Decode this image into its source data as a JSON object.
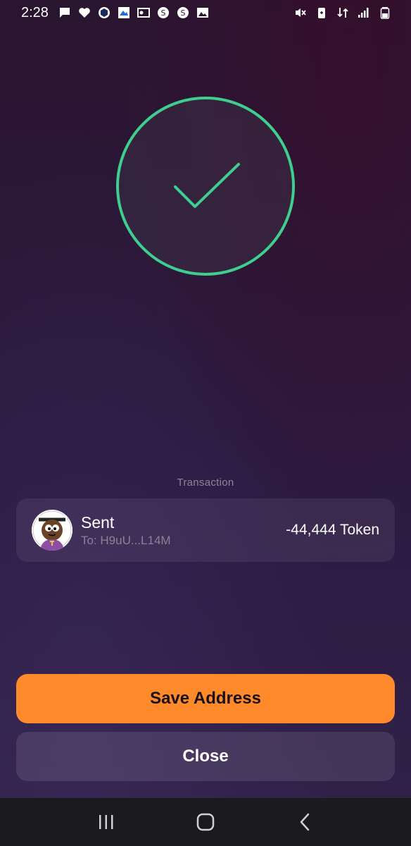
{
  "status_bar": {
    "time": "2:28",
    "left_icons": [
      "chat-bubble-icon",
      "heart-icon",
      "crypto-com-icon",
      "cloud-mountain-icon",
      "outlook-icon",
      "s-circle-icon",
      "s-circle-icon",
      "image-icon"
    ],
    "right_icons": [
      "mute-icon",
      "battery-saver-icon",
      "data-arrows-icon",
      "signal-icon",
      "battery-icon"
    ]
  },
  "success": {
    "icon": "checkmark-icon",
    "accent_color": "#3ecf8e"
  },
  "transaction": {
    "section_label": "Transaction",
    "title": "Sent",
    "recipient": "To: H9uU...L14M",
    "amount": "-44,444 Token",
    "avatar_icon": "token-avatar-icon"
  },
  "buttons": {
    "save_label": "Save Address",
    "close_label": "Close",
    "save_color": "#ff8a2b"
  },
  "nav_bar": {
    "icons": [
      "recent-apps-icon",
      "home-icon",
      "back-icon"
    ]
  }
}
